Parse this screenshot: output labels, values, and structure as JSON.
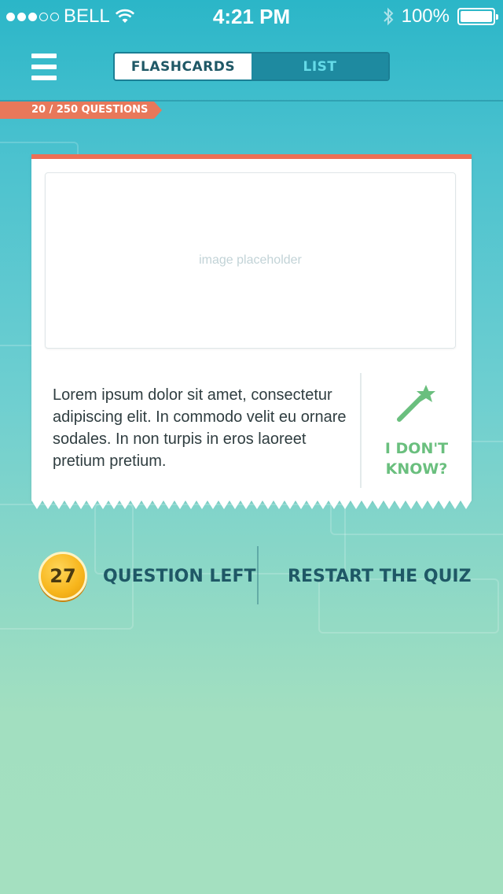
{
  "status_bar": {
    "carrier": "BELL",
    "signal_bars_filled": 3,
    "signal_bars_total": 5,
    "time": "4:21 PM",
    "battery": "100%",
    "icons": [
      "wifi-icon",
      "bluetooth-icon",
      "battery-icon"
    ]
  },
  "header": {
    "menu_icon": "hamburger-menu-icon",
    "tabs": [
      {
        "label": "FLASHCARDS",
        "active": true
      },
      {
        "label": "LIST",
        "active": false
      }
    ]
  },
  "progress": {
    "label": "20 / 250 QUESTIONS",
    "current": 20,
    "total": 250
  },
  "card": {
    "image_placeholder": "image placeholder",
    "question": "Lorem ipsum dolor sit amet, consectetur adipiscing elit. In commodo velit eu ornare sodales. In non turpis in eros laoreet pretium pretium.",
    "idk_line1": "I DON'T",
    "idk_line2": "KNOW?",
    "idk_icon": "magic-wand-icon"
  },
  "footer": {
    "questions_left_count": "27",
    "questions_left_label": "QUESTION LEFT",
    "restart_label": "RESTART THE QUIZ"
  },
  "colors": {
    "accent_orange": "#ec6f55",
    "accent_green": "#6abf7e",
    "text_dark": "#1f5866",
    "tab_inactive": "#1e8aa0"
  }
}
